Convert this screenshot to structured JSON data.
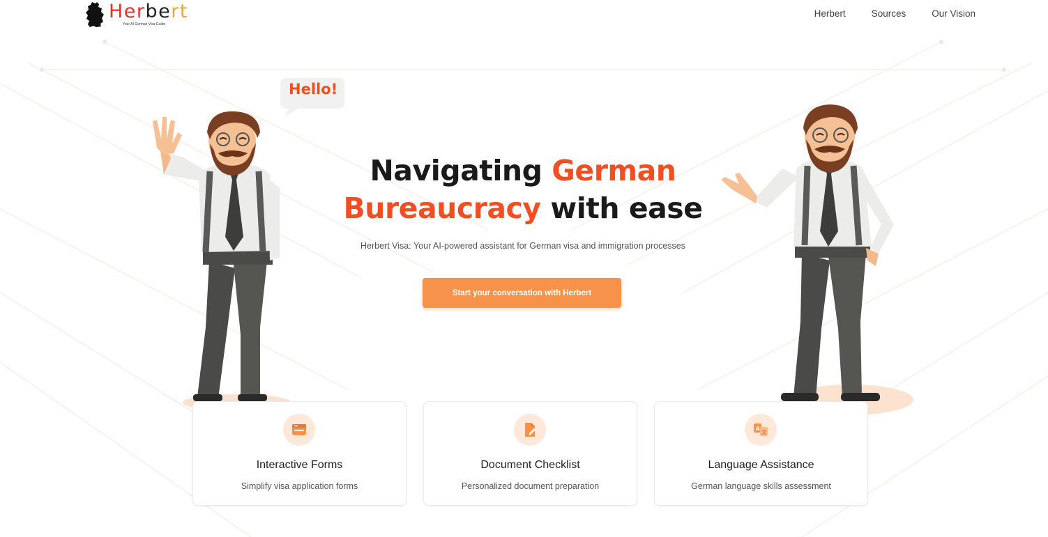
{
  "header": {
    "logo": {
      "part1": "Her",
      "part2": "be",
      "part3": "rt",
      "tagline": "Your AI German Visa Guide"
    },
    "nav": [
      {
        "label": "Herbert"
      },
      {
        "label": "Sources"
      },
      {
        "label": "Our Vision"
      }
    ]
  },
  "hero": {
    "bubble": "Hello!",
    "title_part1": "Navigating ",
    "title_accent1": "German",
    "title_accent2": "Bureaucracy",
    "title_part2": " with ease",
    "subtitle": "Herbert Visa: Your AI-powered assistant for German visa and immigration processes",
    "cta_label": "Start your conversation with Herbert"
  },
  "features": [
    {
      "icon": "form-icon",
      "title": "Interactive Forms",
      "description": "Simplify visa application forms"
    },
    {
      "icon": "document-edit-icon",
      "title": "Document Checklist",
      "description": "Personalized document preparation"
    },
    {
      "icon": "translate-icon",
      "title": "Language Assistance",
      "description": "German language skills assessment"
    }
  ],
  "colors": {
    "accent": "#f04f23",
    "button": "#f7924a",
    "icon_bg": "#fde8d9",
    "icon": "#f7924a"
  }
}
